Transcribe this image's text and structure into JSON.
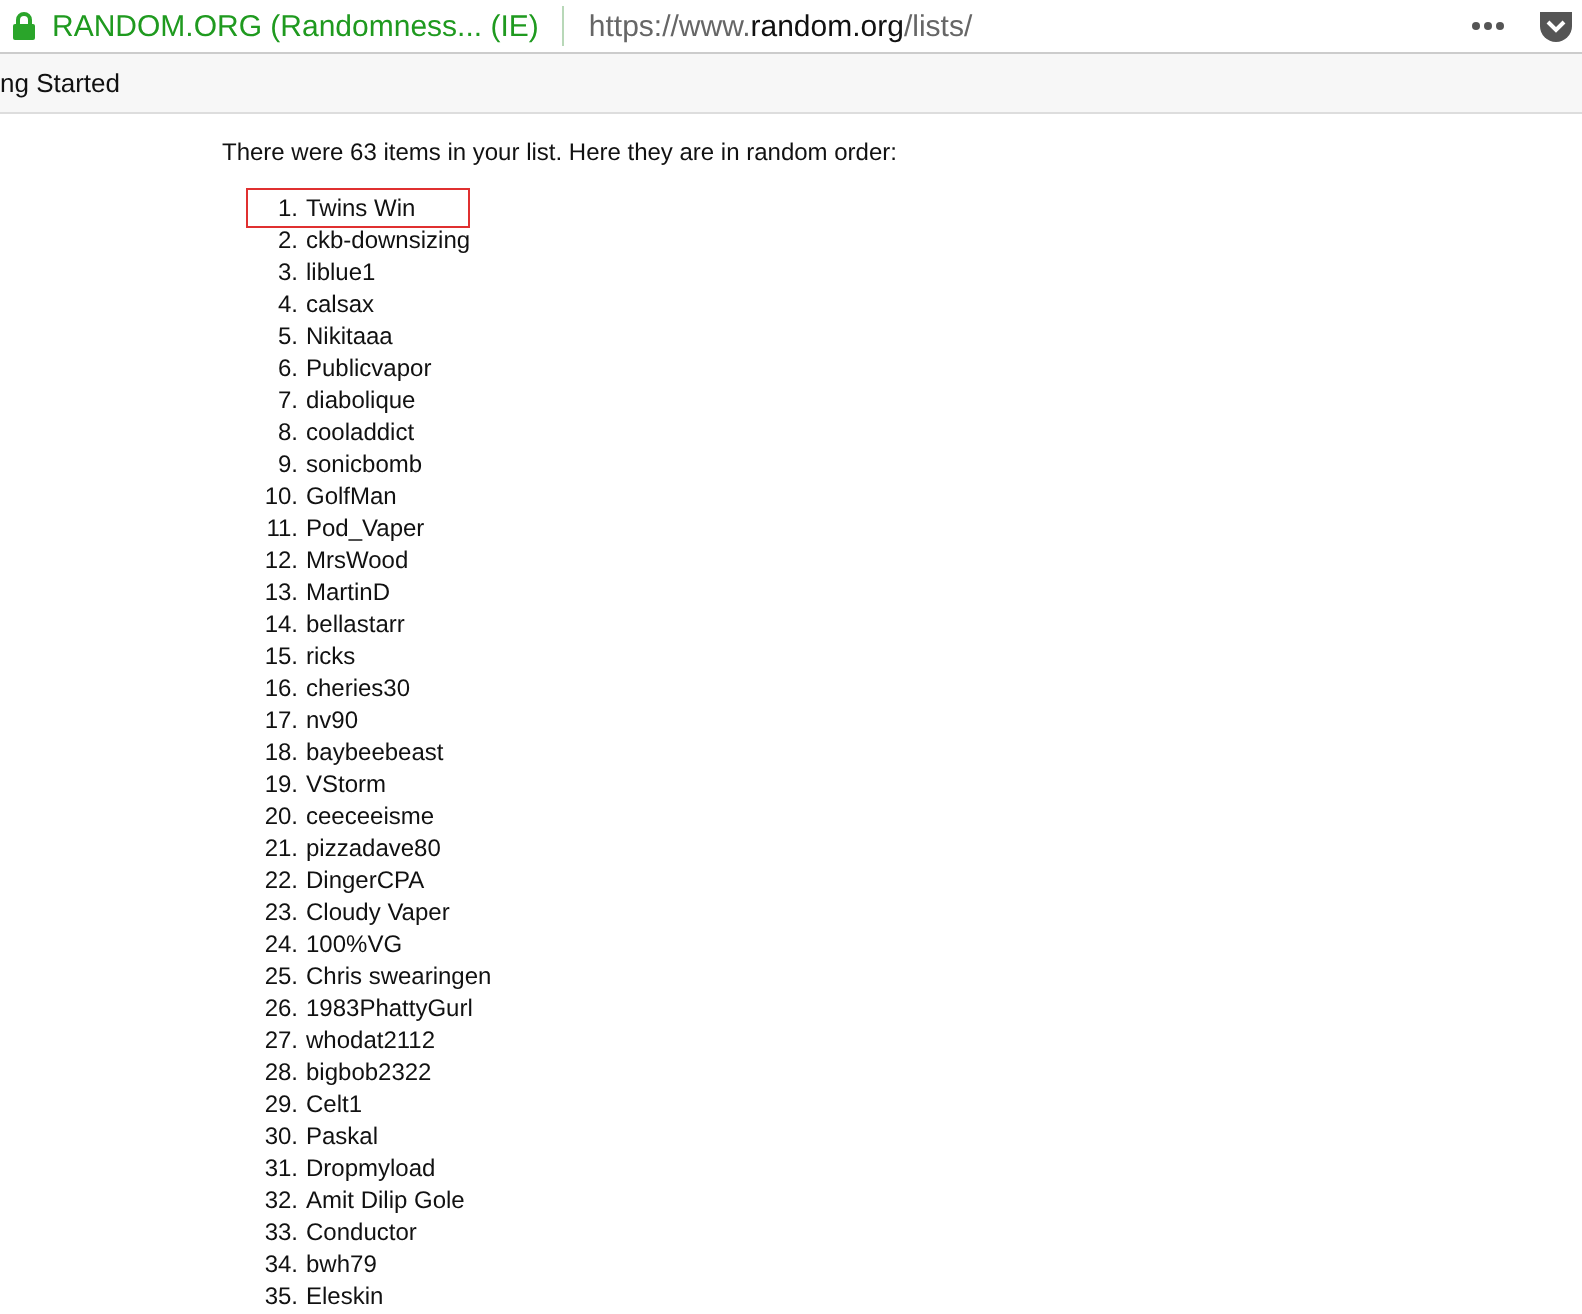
{
  "browser": {
    "site_name": "RANDOM.ORG (Randomness... (IE)",
    "url_prefix": "https://www.",
    "url_domain": "random.org",
    "url_path": "/lists/",
    "bookmark": "ng Started"
  },
  "intro": "There were 63 items in your list. Here they are in random order:",
  "items": [
    {
      "number": "1.",
      "name": "Twins Win",
      "highlighted": true
    },
    {
      "number": "2.",
      "name": "ckb-downsizing",
      "highlighted": false
    },
    {
      "number": "3.",
      "name": "liblue1",
      "highlighted": false
    },
    {
      "number": "4.",
      "name": "calsax",
      "highlighted": false
    },
    {
      "number": "5.",
      "name": "Nikitaaa",
      "highlighted": false
    },
    {
      "number": "6.",
      "name": "Publicvapor",
      "highlighted": false
    },
    {
      "number": "7.",
      "name": "diabolique",
      "highlighted": false
    },
    {
      "number": "8.",
      "name": "cooladdict",
      "highlighted": false
    },
    {
      "number": "9.",
      "name": "sonicbomb",
      "highlighted": false
    },
    {
      "number": "10.",
      "name": "GolfMan",
      "highlighted": false
    },
    {
      "number": "11.",
      "name": "Pod_Vaper",
      "highlighted": false
    },
    {
      "number": "12.",
      "name": "MrsWood",
      "highlighted": false
    },
    {
      "number": "13.",
      "name": "MartinD",
      "highlighted": false
    },
    {
      "number": "14.",
      "name": "bellastarr",
      "highlighted": false
    },
    {
      "number": "15.",
      "name": "ricks",
      "highlighted": false
    },
    {
      "number": "16.",
      "name": "cheries30",
      "highlighted": false
    },
    {
      "number": "17.",
      "name": "nv90",
      "highlighted": false
    },
    {
      "number": "18.",
      "name": "baybeebeast",
      "highlighted": false
    },
    {
      "number": "19.",
      "name": "VStorm",
      "highlighted": false
    },
    {
      "number": "20.",
      "name": "ceeceeisme",
      "highlighted": false
    },
    {
      "number": "21.",
      "name": "pizzadave80",
      "highlighted": false
    },
    {
      "number": "22.",
      "name": "DingerCPA",
      "highlighted": false
    },
    {
      "number": "23.",
      "name": "Cloudy Vaper",
      "highlighted": false
    },
    {
      "number": "24.",
      "name": "100%VG",
      "highlighted": false
    },
    {
      "number": "25.",
      "name": "Chris swearingen",
      "highlighted": false
    },
    {
      "number": "26.",
      "name": "1983PhattyGurl",
      "highlighted": false
    },
    {
      "number": "27.",
      "name": "whodat2112",
      "highlighted": false
    },
    {
      "number": "28.",
      "name": "bigbob2322",
      "highlighted": false
    },
    {
      "number": "29.",
      "name": "Celt1",
      "highlighted": false
    },
    {
      "number": "30.",
      "name": "Paskal",
      "highlighted": false
    },
    {
      "number": "31.",
      "name": "Dropmyload",
      "highlighted": false
    },
    {
      "number": "32.",
      "name": "Amit Dilip Gole",
      "highlighted": false
    },
    {
      "number": "33.",
      "name": "Conductor",
      "highlighted": false
    },
    {
      "number": "34.",
      "name": "bwh79",
      "highlighted": false
    },
    {
      "number": "35.",
      "name": "Eleskin",
      "highlighted": false
    }
  ]
}
